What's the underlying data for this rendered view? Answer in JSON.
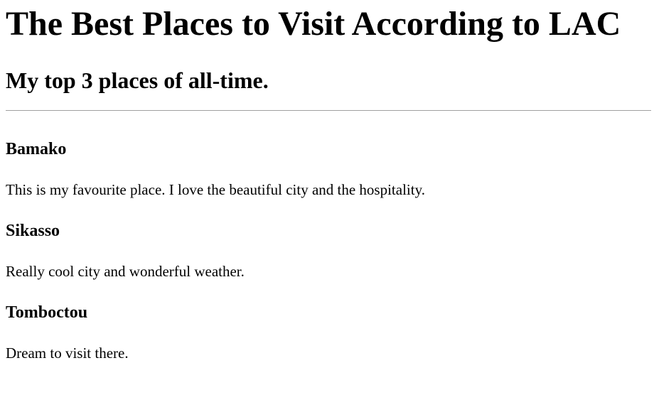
{
  "page": {
    "title": "The Best Places to Visit According to LAC",
    "subtitle": "My top 3 places of all-time."
  },
  "places": [
    {
      "name": "Bamako",
      "description": "This is my favourite place. I love the beautiful city and the hospitality."
    },
    {
      "name": "Sikasso",
      "description": "Really cool city and wonderful weather."
    },
    {
      "name": "Tomboctou",
      "description": "Dream to visit there."
    }
  ]
}
